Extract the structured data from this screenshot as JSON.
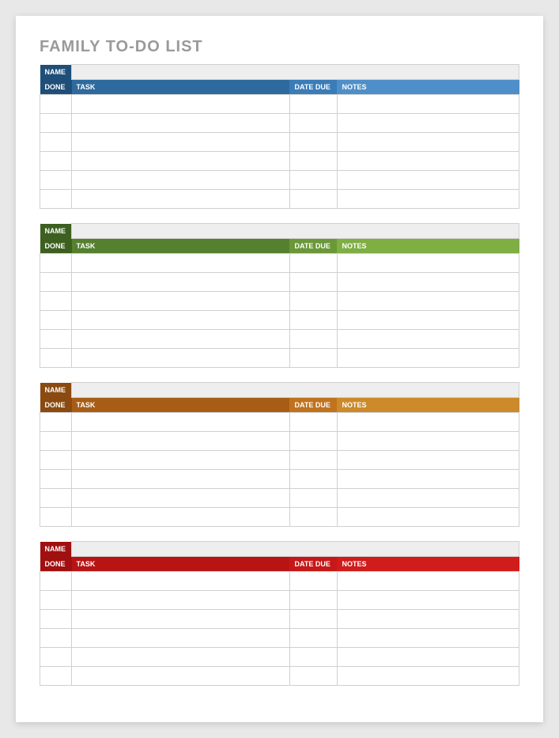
{
  "title": "FAMILY TO-DO LIST",
  "labels": {
    "name": "NAME",
    "done": "DONE",
    "task": "TASK",
    "dateDue": "DATE DUE",
    "notes": "NOTES"
  },
  "sections": [
    {
      "theme": "blue",
      "name": "",
      "rows": [
        {},
        {},
        {},
        {},
        {},
        {}
      ]
    },
    {
      "theme": "green",
      "name": "",
      "rows": [
        {},
        {},
        {},
        {},
        {},
        {}
      ]
    },
    {
      "theme": "brown",
      "name": "",
      "rows": [
        {},
        {},
        {},
        {},
        {},
        {}
      ]
    },
    {
      "theme": "red",
      "name": "",
      "rows": [
        {},
        {},
        {},
        {},
        {},
        {}
      ]
    }
  ]
}
